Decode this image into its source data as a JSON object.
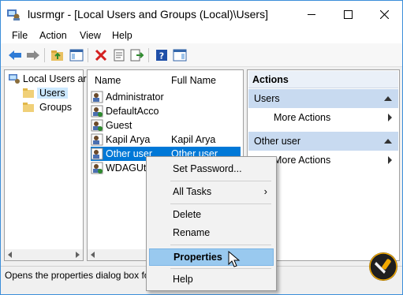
{
  "window": {
    "title": "lusrmgr - [Local Users and Groups (Local)\\Users]",
    "controls": [
      "minimize",
      "maximize",
      "close"
    ]
  },
  "menu": [
    "File",
    "Action",
    "View",
    "Help"
  ],
  "toolbar": [
    "back-icon",
    "forward-icon",
    "up-folder-icon",
    "show-hide-tree-icon",
    "delete-icon",
    "properties-icon",
    "export-list-icon",
    "help-icon",
    "show-hide-action-pane-icon"
  ],
  "tree": {
    "root": "Local Users ar",
    "children": [
      "Users",
      "Groups"
    ]
  },
  "list": {
    "columns": [
      "Name",
      "Full Name"
    ],
    "rows": [
      {
        "name": "Administrator",
        "full_name": ""
      },
      {
        "name": "DefaultAcco",
        "full_name": ""
      },
      {
        "name": "Guest",
        "full_name": ""
      },
      {
        "name": "Kapil Arya",
        "full_name": "Kapil Arya"
      },
      {
        "name": "Other user",
        "full_name": "Other user"
      },
      {
        "name": "WDAGUtil",
        "full_name": ""
      }
    ],
    "selected_row": "Other user"
  },
  "actions": {
    "header": "Actions",
    "sections": [
      {
        "title": "Users",
        "item": "More Actions"
      },
      {
        "title": "Other user",
        "item": "More Actions"
      }
    ]
  },
  "context_menu": {
    "items": [
      "Set Password...",
      "All Tasks",
      "Delete",
      "Rename",
      "Properties",
      "Help"
    ],
    "highlighted": "Properties"
  },
  "status": {
    "text": "Opens the properties dialog box fo"
  },
  "colors": {
    "selection": "#0078d7",
    "actions_section": "#c8daf0",
    "menu_highlight": "#99c9ef",
    "window_border": "#3c8ed9"
  }
}
